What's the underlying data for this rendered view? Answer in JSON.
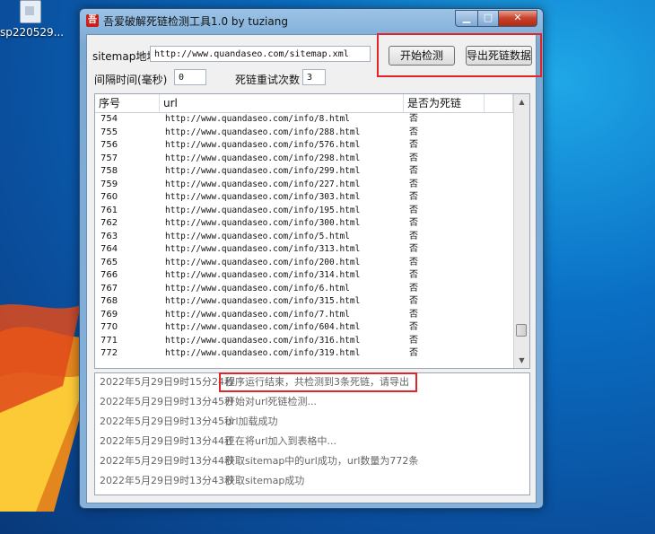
{
  "desktop": {
    "icon_label": "sp220529..."
  },
  "window": {
    "title": "吾爱破解死链检测工具1.0 by tuziang",
    "controls": {
      "minimize": "▁",
      "maximize": "□",
      "close": "✕"
    }
  },
  "form": {
    "sitemap_label": "sitemap地址",
    "sitemap_value": "http://www.quandaseo.com/sitemap.xml",
    "interval_label": "间隔时间(毫秒)",
    "interval_value": "0",
    "retry_label": "死链重试次数",
    "retry_value": "3",
    "start_button": "开始检测",
    "export_button": "导出死链数据"
  },
  "table": {
    "headers": [
      "序号",
      "url",
      "是否为死链"
    ],
    "rows": [
      {
        "no": "754",
        "url": "http://www.quandaseo.com/info/8.html",
        "dead": "否"
      },
      {
        "no": "755",
        "url": "http://www.quandaseo.com/info/288.html",
        "dead": "否"
      },
      {
        "no": "756",
        "url": "http://www.quandaseo.com/info/576.html",
        "dead": "否"
      },
      {
        "no": "757",
        "url": "http://www.quandaseo.com/info/298.html",
        "dead": "否"
      },
      {
        "no": "758",
        "url": "http://www.quandaseo.com/info/299.html",
        "dead": "否"
      },
      {
        "no": "759",
        "url": "http://www.quandaseo.com/info/227.html",
        "dead": "否"
      },
      {
        "no": "760",
        "url": "http://www.quandaseo.com/info/303.html",
        "dead": "否"
      },
      {
        "no": "761",
        "url": "http://www.quandaseo.com/info/195.html",
        "dead": "否"
      },
      {
        "no": "762",
        "url": "http://www.quandaseo.com/info/300.html",
        "dead": "否"
      },
      {
        "no": "763",
        "url": "http://www.quandaseo.com/info/5.html",
        "dead": "否"
      },
      {
        "no": "764",
        "url": "http://www.quandaseo.com/info/313.html",
        "dead": "否"
      },
      {
        "no": "765",
        "url": "http://www.quandaseo.com/info/200.html",
        "dead": "否"
      },
      {
        "no": "766",
        "url": "http://www.quandaseo.com/info/314.html",
        "dead": "否"
      },
      {
        "no": "767",
        "url": "http://www.quandaseo.com/info/6.html",
        "dead": "否"
      },
      {
        "no": "768",
        "url": "http://www.quandaseo.com/info/315.html",
        "dead": "否"
      },
      {
        "no": "769",
        "url": "http://www.quandaseo.com/info/7.html",
        "dead": "否"
      },
      {
        "no": "770",
        "url": "http://www.quandaseo.com/info/604.html",
        "dead": "否"
      },
      {
        "no": "771",
        "url": "http://www.quandaseo.com/info/316.html",
        "dead": "否"
      },
      {
        "no": "772",
        "url": "http://www.quandaseo.com/info/319.html",
        "dead": "否"
      }
    ]
  },
  "log": [
    {
      "time": "2022年5月29日9时15分24秒",
      "msg": "程序运行结束，共检测到3条死链，请导出"
    },
    {
      "time": "2022年5月29日9时13分45秒",
      "msg": "开始对url死链检测..."
    },
    {
      "time": "2022年5月29日9时13分45秒",
      "msg": "url加载成功"
    },
    {
      "time": "2022年5月29日9时13分44秒",
      "msg": "正在将url加入到表格中..."
    },
    {
      "time": "2022年5月29日9时13分44秒",
      "msg": "获取sitemap中的url成功，url数量为772条"
    },
    {
      "time": "2022年5月29日9时13分43秒",
      "msg": "获取sitemap成功"
    }
  ],
  "icons": [
    "file-icon",
    "app-icon",
    "scroll-up-icon",
    "scroll-down-icon"
  ]
}
